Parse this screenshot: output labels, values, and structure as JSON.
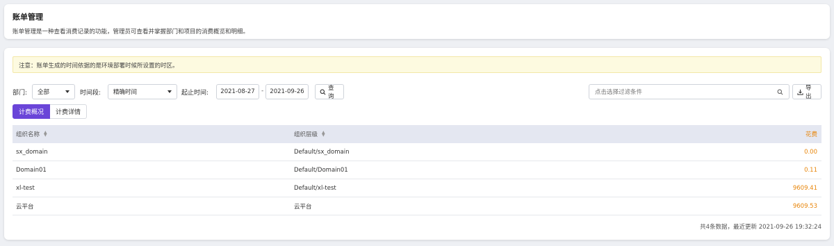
{
  "header": {
    "title": "账单管理",
    "description": "账单管理是一种查看消费记录的功能，管理员可查看并掌握部门和项目的消费概览和明细。"
  },
  "notice": "注意：账单生成的时间依据的是环境部署时候所设置的时区。",
  "filters": {
    "department_label": "部门:",
    "department_value": "全部",
    "period_label": "时间段:",
    "period_value": "精确时间",
    "range_label": "起止时间:",
    "start_date": "2021-08-27",
    "range_separator": "-",
    "end_date": "2021-09-26",
    "query_label": "查询",
    "search_placeholder": "点击选择过滤条件",
    "export_label": "导出"
  },
  "tabs": [
    {
      "label": "计费概况",
      "active": true
    },
    {
      "label": "计费详情",
      "active": false
    }
  ],
  "table": {
    "columns": [
      "组织名称",
      "组织层级",
      "花费"
    ],
    "rows": [
      {
        "name": "sx_domain",
        "level": "Default/sx_domain",
        "cost": "0.00"
      },
      {
        "name": "Domain01",
        "level": "Default/Domain01",
        "cost": "0.11"
      },
      {
        "name": "xl-test",
        "level": "Default/xl-test",
        "cost": "9609.41"
      },
      {
        "name": "云平台",
        "level": "云平台",
        "cost": "9609.53"
      }
    ]
  },
  "footer": "共4条数据，最近更新 2021-09-26 19:32:24",
  "colors": {
    "accent": "#6a45d8",
    "cost": "#e8860b",
    "notice_bg": "#fdfae0"
  }
}
